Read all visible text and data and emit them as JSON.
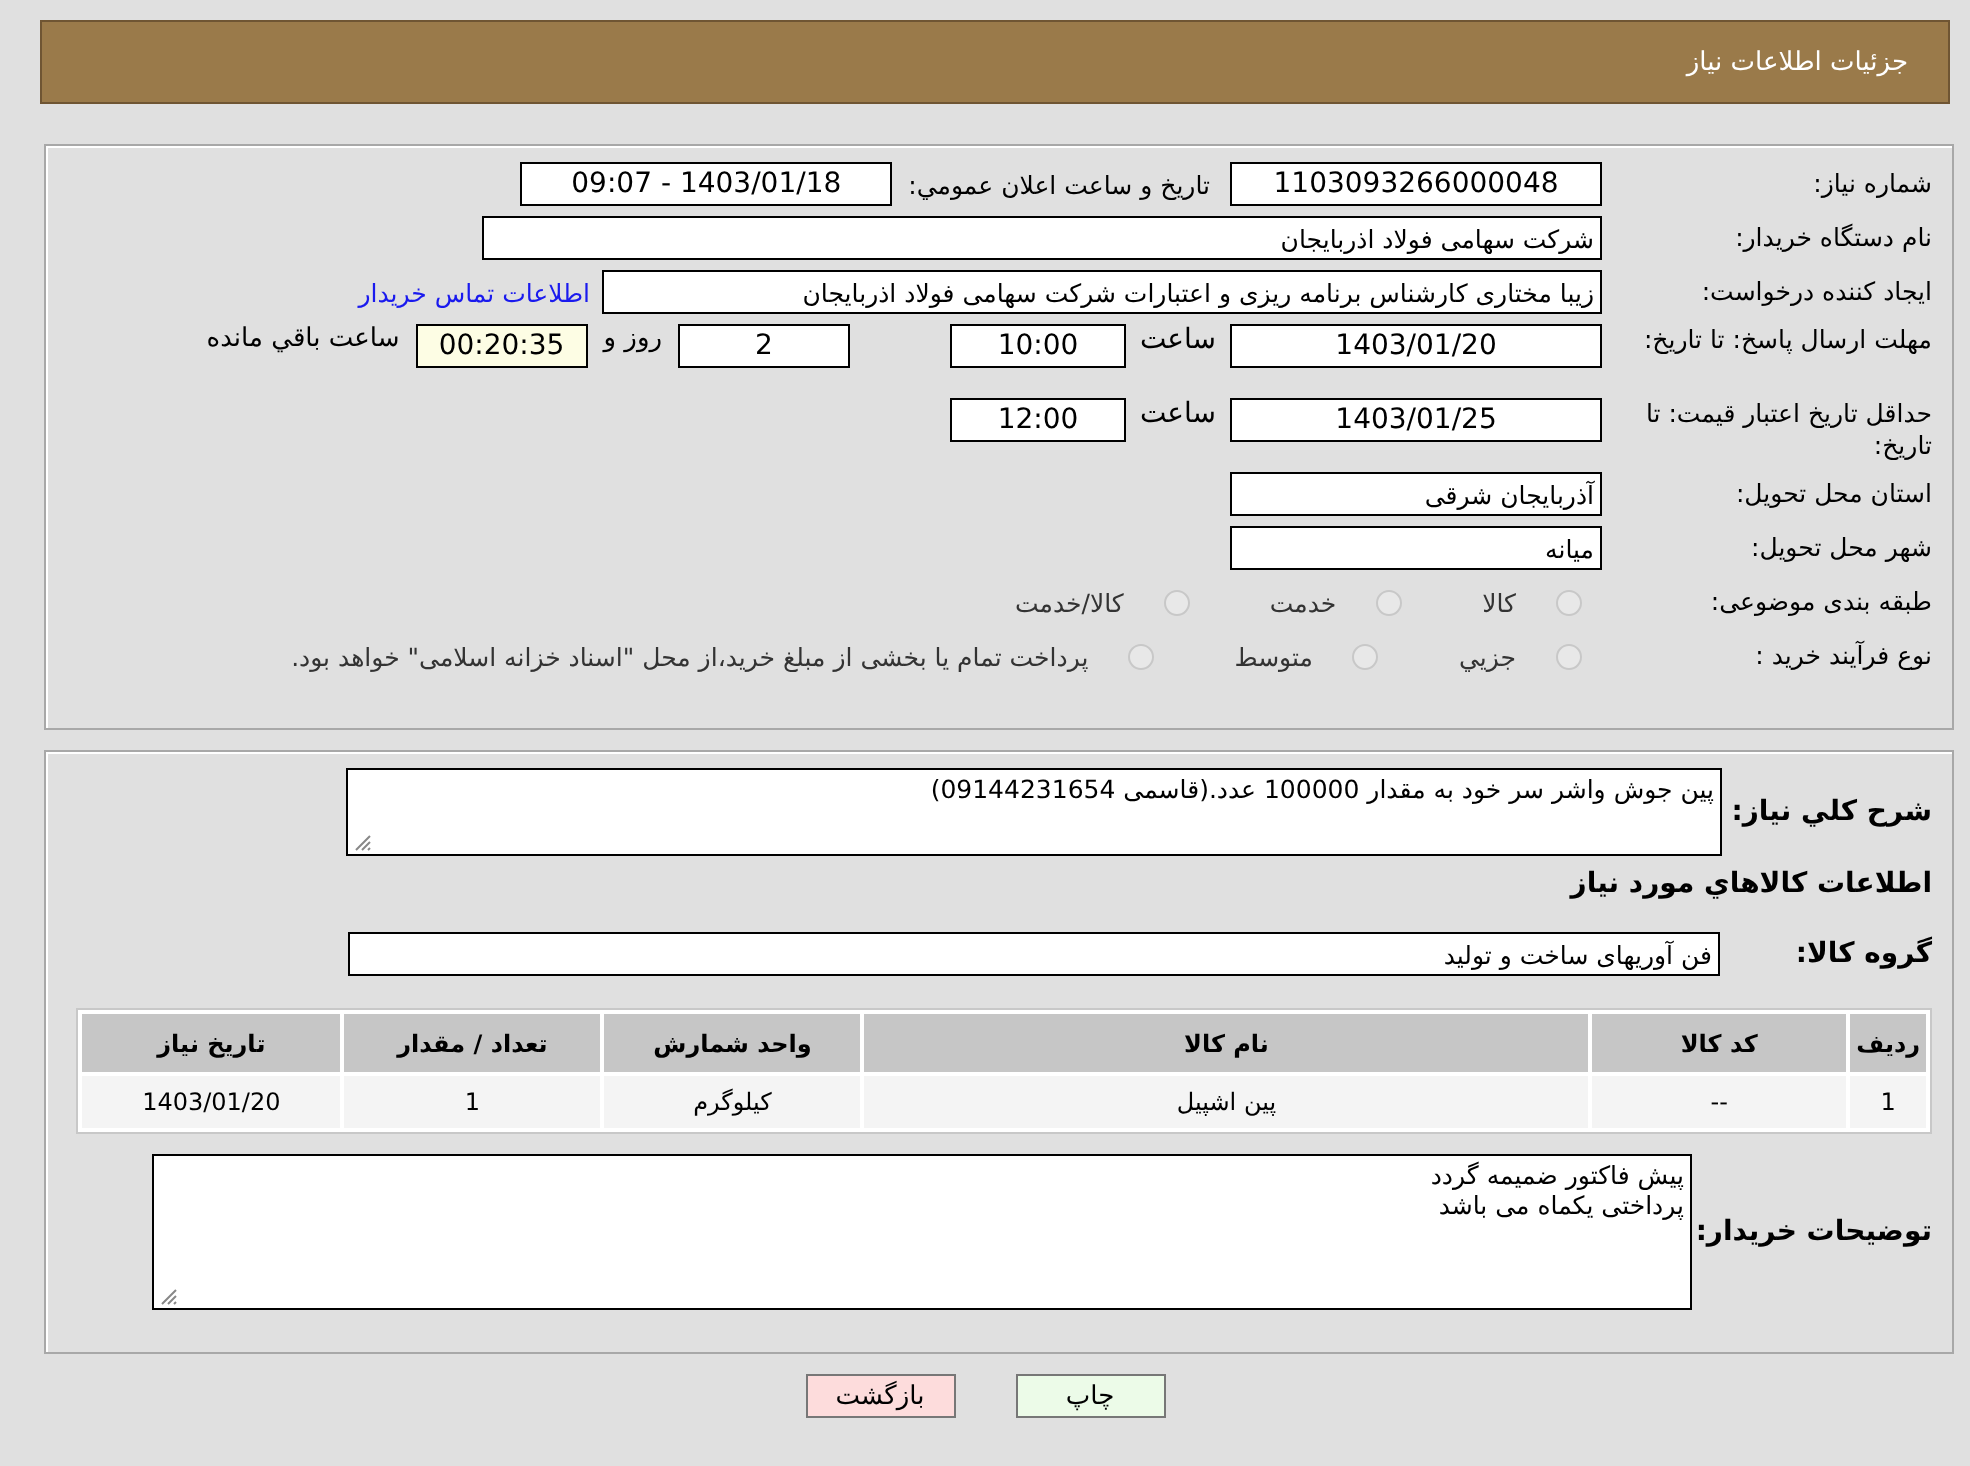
{
  "header": {
    "title": "جزئیات اطلاعات نیاز"
  },
  "details": {
    "need_number": {
      "label": "شماره نياز:",
      "value": "1103093266000048"
    },
    "announce": {
      "label": "تاريخ و ساعت اعلان عمومي:",
      "value": "1403/01/18 - 09:07"
    },
    "buyer": {
      "label": "نام دستگاه خريدار:",
      "value": "شرکت سهامی فولاد اذربایجان"
    },
    "creator": {
      "label": "ایجاد کننده درخواست:",
      "value": "زیبا مختاری کارشناس برنامه ریزی و اعتبارات شرکت سهامی فولاد اذربایجان",
      "link": "اطلاعات تماس خريدار"
    },
    "reply_deadline": {
      "label": "مهلت ارسال پاسخ: تا تاریخ:",
      "date": "1403/01/20",
      "time_label": "ساعت",
      "time": "10:00",
      "days": "2",
      "days_label": "روز و",
      "remaining": "00:20:35",
      "remaining_label": "ساعت باقي مانده"
    },
    "price_validity": {
      "label": "حداقل تاریخ اعتبار قیمت: تا تاریخ:",
      "date": "1403/01/25",
      "time_label": "ساعت",
      "time": "12:00"
    },
    "province": {
      "label": "استان محل تحویل:",
      "value": "آذربایجان شرقی"
    },
    "city": {
      "label": "شهر محل تحویل:",
      "value": "میانه"
    },
    "category": {
      "label": "طبقه بندی موضوعی:",
      "options": [
        {
          "label": "کالا",
          "selected": false
        },
        {
          "label": "خدمت",
          "selected": false
        },
        {
          "label": "کالا/خدمت",
          "selected": false
        }
      ]
    },
    "process": {
      "label": "نوع فرآیند خرید :",
      "options": [
        {
          "label": "جزيي",
          "selected": false
        },
        {
          "label": "متوسط",
          "selected": false
        },
        {
          "label": "پرداخت تمام یا بخشی از مبلغ خرید،از محل \"اسناد خزانه اسلامی\" خواهد بود.",
          "selected": false
        }
      ]
    }
  },
  "goods": {
    "summary": {
      "label": "شرح كلي نياز:",
      "value": "پین جوش واشر سر خود به مقدار 100000 عدد.(قاسمی 09144231654)"
    },
    "section_title": "اطلاعات كالاهاي مورد نياز",
    "group": {
      "label": "گروه کالا:",
      "value": "فن آوریهای ساخت و تولید"
    },
    "table": {
      "columns": [
        "رديف",
        "کد کالا",
        "نام کالا",
        "واحد شمارش",
        "تعداد / مقدار",
        "تاریخ نیاز"
      ],
      "rows": [
        [
          "1",
          "--",
          "پین اشپیل",
          "کیلوگرم",
          "1",
          "1403/01/20"
        ]
      ]
    },
    "buyer_notes": {
      "label": "توضیحات خریدار:",
      "lines": [
        "پیش فاکتور ضمیمه گردد",
        "پرداختی یکماه می باشد"
      ]
    }
  },
  "buttons": [
    {
      "label": "چاپ",
      "kind": "print"
    },
    {
      "label": "بازگشت",
      "kind": "back"
    }
  ]
}
